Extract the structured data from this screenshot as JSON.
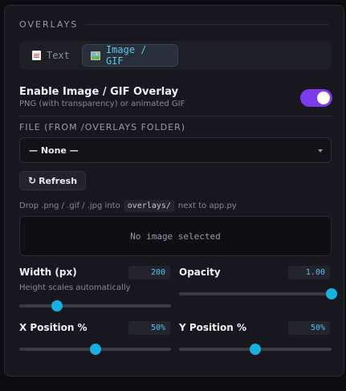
{
  "section": {
    "title": "OVERLAYS"
  },
  "tabs": [
    {
      "label": "Text",
      "icon": "document-icon",
      "active": false
    },
    {
      "label": "Image / GIF",
      "icon": "picture-icon",
      "active": true
    }
  ],
  "enable": {
    "title": "Enable Image / GIF Overlay",
    "subtitle": "PNG (with transparency) or animated GIF",
    "on": true
  },
  "file": {
    "label": "FILE (FROM /OVERLAYS FOLDER)",
    "selected": "— None —"
  },
  "refresh_label": "Refresh",
  "hint": {
    "before": "Drop .png / .gif / .jpg into",
    "code": "overlays/",
    "after": "next to app.py"
  },
  "preview_text": "No image selected",
  "width": {
    "label": "Width (px)",
    "value": "200",
    "note": "Height scales automatically",
    "level": 0.25
  },
  "opacity": {
    "label": "Opacity",
    "value": "1.00",
    "level": 1.0
  },
  "xpos": {
    "label": "X Position %",
    "value": "50%",
    "level": 0.5
  },
  "ypos": {
    "label": "Y Position %",
    "value": "50%",
    "level": 0.5
  },
  "colors": {
    "accent": "#7c3aed",
    "slider": "#17b0e0",
    "tab_active": "#5fc6e8",
    "panel": "#17171d"
  }
}
